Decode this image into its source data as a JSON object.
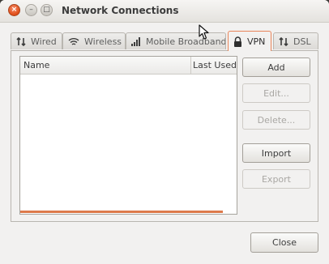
{
  "window": {
    "title": "Network Connections",
    "controls": {
      "close": "×",
      "minimize": "–",
      "maximize": "□"
    }
  },
  "tabs": [
    {
      "label": "Wired",
      "icon": "wired-arrows-icon",
      "active": false
    },
    {
      "label": "Wireless",
      "icon": "wifi-icon",
      "active": false
    },
    {
      "label": "Mobile Broadband",
      "icon": "signal-bars-icon",
      "active": false
    },
    {
      "label": "VPN",
      "icon": "lock-icon",
      "active": true
    },
    {
      "label": "DSL",
      "icon": "dsl-arrows-icon",
      "active": false
    }
  ],
  "list": {
    "columns": [
      "Name",
      "Last Used"
    ],
    "rows": []
  },
  "buttons": {
    "add": "Add",
    "edit": "Edit...",
    "delete": "Delete...",
    "import": "Import",
    "export": "Export"
  },
  "footer": {
    "close": "Close"
  },
  "colors": {
    "accent": "#dd7a4b",
    "window_bg": "#f2f1f0",
    "close_button": "#df4b16"
  }
}
